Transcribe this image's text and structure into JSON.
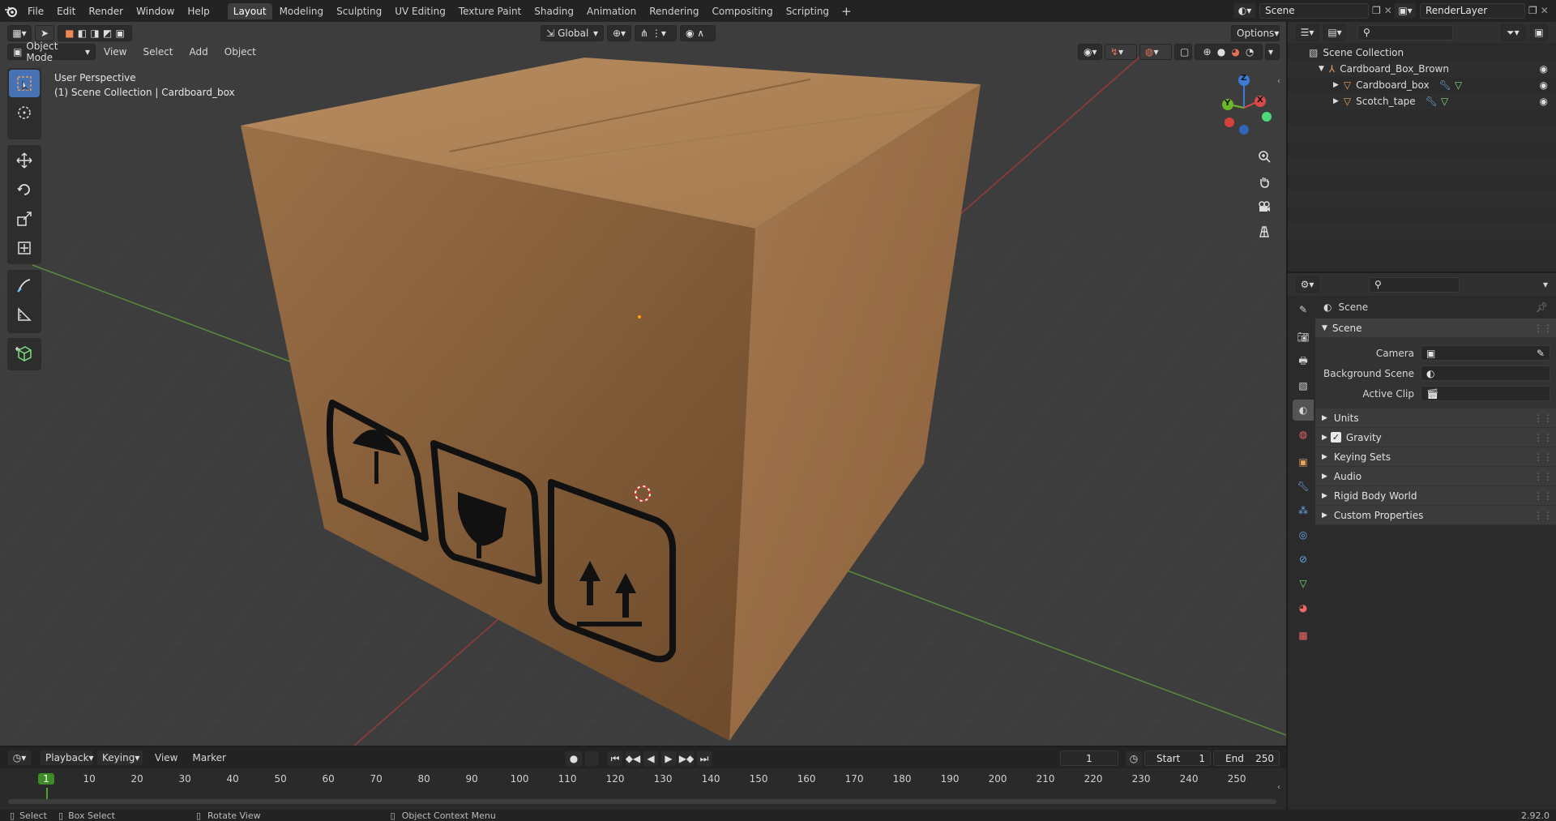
{
  "topbar": {
    "menus": [
      "File",
      "Edit",
      "Render",
      "Window",
      "Help"
    ],
    "tabs": [
      "Layout",
      "Modeling",
      "Sculpting",
      "UV Editing",
      "Texture Paint",
      "Shading",
      "Animation",
      "Rendering",
      "Compositing",
      "Scripting"
    ],
    "active_tab": "Layout",
    "add_tab": "+",
    "scene_name": "Scene",
    "render_layer": "RenderLayer"
  },
  "viewport": {
    "mode": "Object Mode",
    "menus": [
      "View",
      "Select",
      "Add",
      "Object"
    ],
    "transform": "Global",
    "options": "Options",
    "overlay_title": "User Perspective",
    "overlay_sub": "(1) Scene Collection | Cardboard_box",
    "gizmo": {
      "x": "X",
      "y": "Y",
      "z": "Z"
    }
  },
  "outliner": {
    "root": "Scene Collection",
    "items": [
      {
        "name": "Cardboard_Box_Brown",
        "level": 1
      },
      {
        "name": "Cardboard_box",
        "level": 2
      },
      {
        "name": "Scotch_tape",
        "level": 2
      }
    ]
  },
  "properties": {
    "breadcrumb": "Scene",
    "panel_title": "Scene",
    "fields": [
      {
        "label": "Camera",
        "value": ""
      },
      {
        "label": "Background Scene",
        "value": ""
      },
      {
        "label": "Active Clip",
        "value": ""
      }
    ],
    "sections": [
      "Units",
      "Gravity",
      "Keying Sets",
      "Audio",
      "Rigid Body World",
      "Custom Properties"
    ]
  },
  "timeline": {
    "menus": [
      "Playback",
      "Keying",
      "View",
      "Marker"
    ],
    "current_frame": "1",
    "start_label": "Start",
    "start": "1",
    "end_label": "End",
    "end": "250",
    "ruler": [
      "1",
      "10",
      "20",
      "30",
      "40",
      "50",
      "60",
      "70",
      "80",
      "90",
      "100",
      "110",
      "120",
      "130",
      "140",
      "150",
      "160",
      "170",
      "180",
      "190",
      "200",
      "210",
      "220",
      "230",
      "240",
      "250"
    ]
  },
  "statusbar": {
    "select": "Select",
    "box_select": "Box Select",
    "rotate_view": "Rotate View",
    "context_menu": "Object Context Menu",
    "version": "2.92.0"
  },
  "colors": {
    "accent": "#4772b3",
    "active_frame": "#3d8c28",
    "header": "#232323",
    "viewport": "#3d3d3d"
  }
}
